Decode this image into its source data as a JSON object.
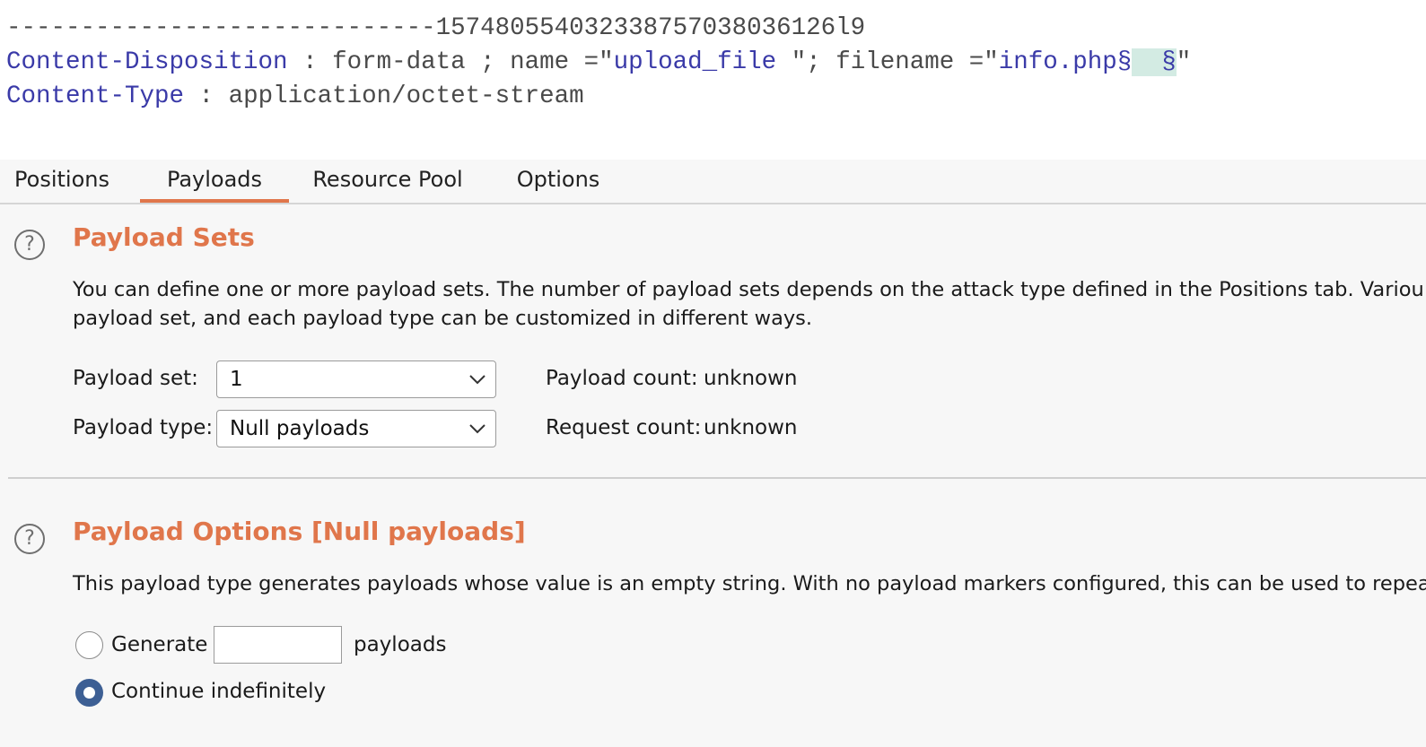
{
  "request": {
    "boundary": "-----------------------------157480554032338757038036126l9",
    "disposition": {
      "header": "Content-Disposition",
      "sep": " : ",
      "value_start": "form-data ; name =\"",
      "field_name": "upload_file ",
      "value_mid": "\"; filename =\"",
      "file_name": "info.php",
      "marker_open": "§",
      "marker_body": "  §",
      "value_end": "\""
    },
    "content_type": {
      "header": "Content-Type",
      "sep": " : ",
      "value": "application/octet-stream"
    }
  },
  "tabs": [
    {
      "label": "Positions"
    },
    {
      "label": "Payloads"
    },
    {
      "label": "Resource Pool"
    },
    {
      "label": "Options"
    }
  ],
  "payload_sets": {
    "help_glyph": "?",
    "title": "Payload Sets",
    "desc_line1": "You can define one or more payload sets. The number of payload sets depends on the attack type defined in the Positions tab. Variou",
    "desc_line2": "payload set, and each payload type can be customized in different ways.",
    "set_label": "Payload set:",
    "set_value": "1",
    "type_label": "Payload type:",
    "type_value": "Null payloads",
    "payload_count_label": "Payload count:",
    "payload_count_value": "unknown",
    "request_count_label": "Request count:",
    "request_count_value": "unknown"
  },
  "payload_options": {
    "help_glyph": "?",
    "title": "Payload Options [Null payloads]",
    "desc": "This payload type generates payloads whose value is an empty string. With no payload markers configured, this can be used to repeat",
    "generate_label": "Generate",
    "generate_value": "",
    "payloads_suffix": "payloads",
    "continue_label": "Continue indefinitely",
    "selected": "continue"
  },
  "colors": {
    "accent": "#e0764b",
    "radio_selected": "#3d5f94",
    "header_blue": "#3a3aa8",
    "marker_highlight": "#d3ebe3"
  }
}
